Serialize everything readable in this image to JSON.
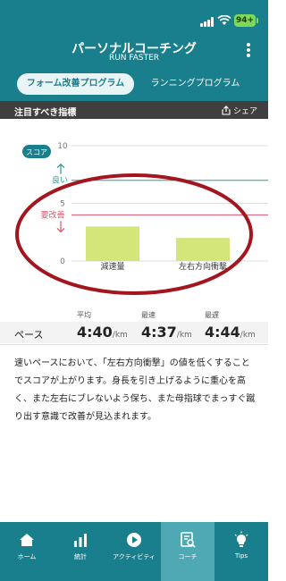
{
  "status": {
    "battery": "94+"
  },
  "header": {
    "title": "パーソナルコーチング",
    "subtitle": "RUN FASTER"
  },
  "tabs": [
    {
      "label": "フォーム改善プログラム",
      "active": true
    },
    {
      "label": "ランニングプログラム",
      "active": false
    }
  ],
  "section": {
    "title": "注目すべき指標",
    "share_label": "シェア"
  },
  "chart_data": {
    "type": "bar",
    "badge": "スコア",
    "categories": [
      "減速量",
      "左右方向衝撃"
    ],
    "values": [
      3.0,
      2.0
    ],
    "ylim": [
      0,
      10
    ],
    "yticks": [
      0,
      5,
      10
    ],
    "good_line": {
      "value": 7,
      "label": "良い"
    },
    "improve_line": {
      "value": 4,
      "label": "要改善"
    },
    "colors": {
      "bar": "#d4e57a",
      "good": "#2a9d8f",
      "improve": "#e2536b",
      "annotation": "#a3161f"
    }
  },
  "stats": {
    "row_label": "ペース",
    "columns": [
      {
        "header": "平均",
        "value": "4:40",
        "unit": "/km"
      },
      {
        "header": "最速",
        "value": "4:37",
        "unit": "/km"
      },
      {
        "header": "最遅",
        "value": "4:44",
        "unit": "/km"
      }
    ]
  },
  "description": "速いペースにおいて、「左右方向衝撃」の値を低くすることでスコアが上がります。身長を引き上げるように重心を高く、また左右にブレないよう保ち、また母指球でまっすぐ蹴り出す意識で改善が見込まれます。",
  "tabbar": [
    {
      "label": "ホーム",
      "icon": "home-icon",
      "active": false
    },
    {
      "label": "統計",
      "icon": "stats-icon",
      "active": false
    },
    {
      "label": "アクティビティ",
      "icon": "play-icon",
      "active": false
    },
    {
      "label": "コーチ",
      "icon": "coach-icon",
      "active": true
    },
    {
      "label": "Tips",
      "icon": "bulb-icon",
      "active": false
    }
  ]
}
